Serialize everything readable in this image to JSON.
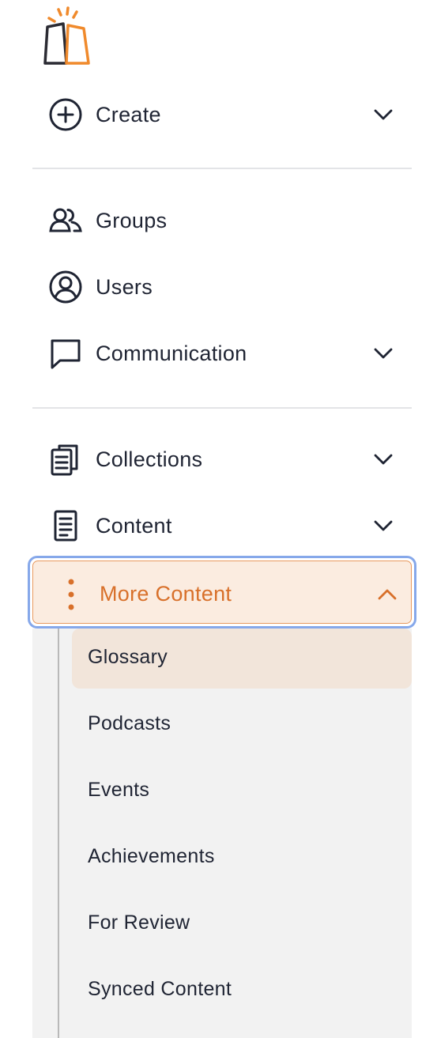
{
  "nav": {
    "create": "Create",
    "groups": "Groups",
    "users": "Users",
    "communication": "Communication",
    "collections": "Collections",
    "content": "Content",
    "more_content": "More Content"
  },
  "submenu": [
    "Glossary",
    "Podcasts",
    "Events",
    "Achievements",
    "For Review",
    "Synced Content"
  ],
  "colors": {
    "accent": "#d8702a",
    "active_bg": "#fbece0",
    "focus_ring": "#86a8ea",
    "submenu_bg": "#f2f2f2"
  }
}
